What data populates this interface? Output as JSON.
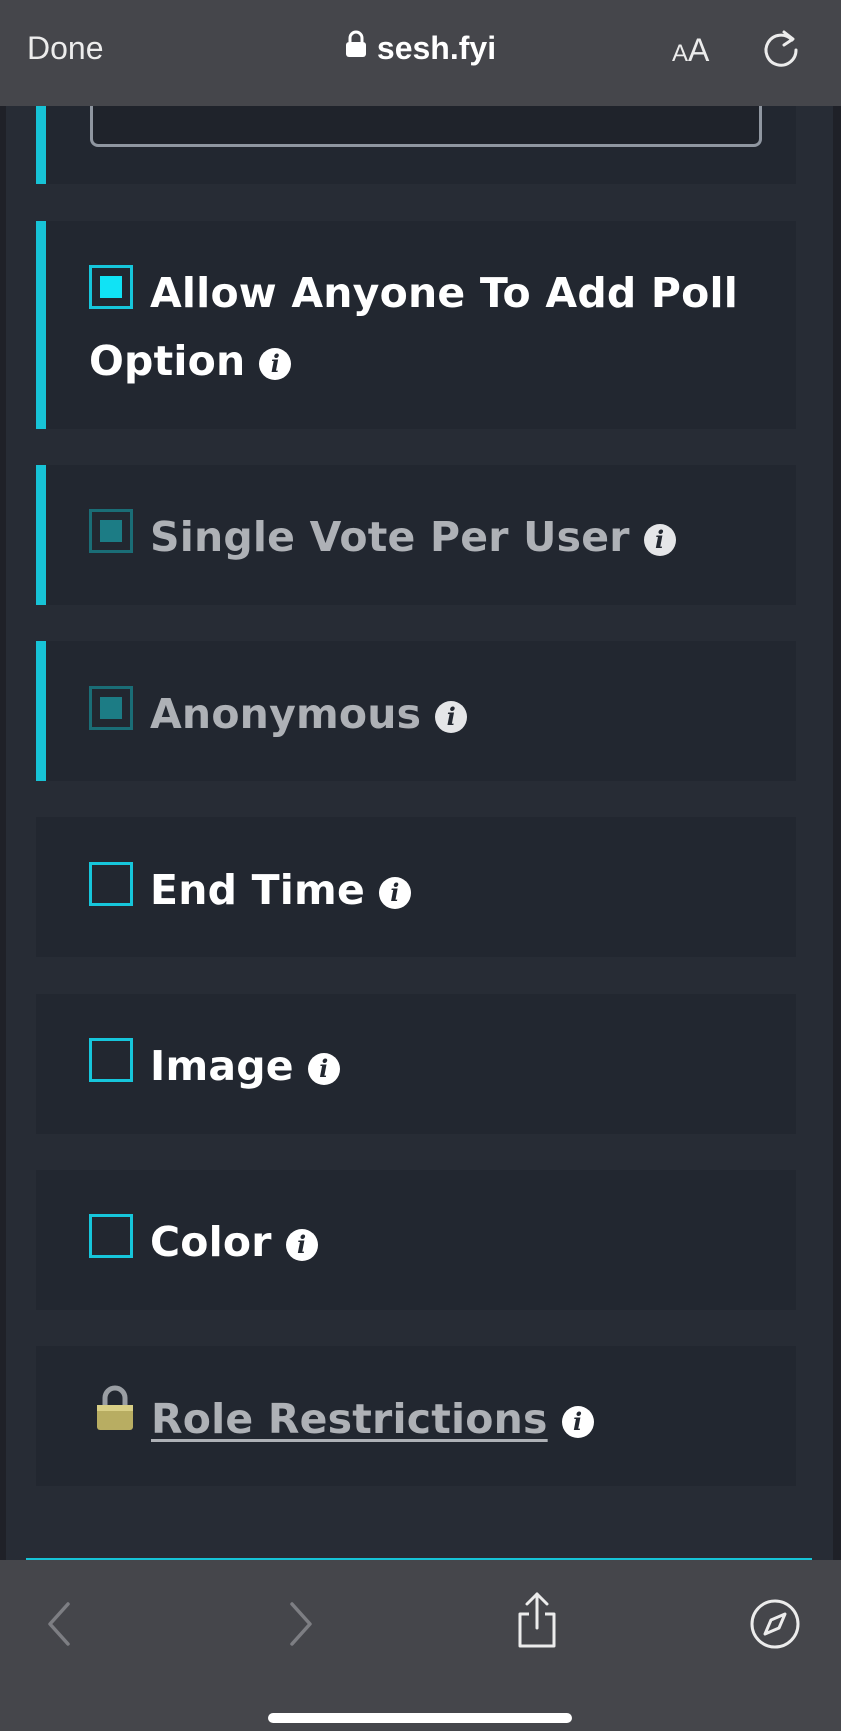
{
  "browser": {
    "done_label": "Done",
    "url": "sesh.fyi",
    "text_size_small": "A",
    "text_size_large": "A"
  },
  "options": {
    "allow_add": {
      "label_line1": "Allow Anyone To Add Poll",
      "label_line2": "Option",
      "checked": true
    },
    "single_vote": {
      "label": "Single Vote Per User",
      "checked": true,
      "disabled": true
    },
    "anonymous": {
      "label": "Anonymous",
      "checked": true,
      "disabled": true
    },
    "end_time": {
      "label": "End Time",
      "checked": false
    },
    "image": {
      "label": "Image",
      "checked": false
    },
    "color": {
      "label": "Color",
      "checked": false
    },
    "role_restrictions": {
      "label": "Role Restrictions",
      "locked": true
    }
  },
  "icons": {
    "info": "i",
    "lock": "🔒"
  },
  "colors": {
    "accent": "#17c3d6",
    "panel": "#222730",
    "background": "#272c35",
    "browser_chrome": "#45464b"
  }
}
